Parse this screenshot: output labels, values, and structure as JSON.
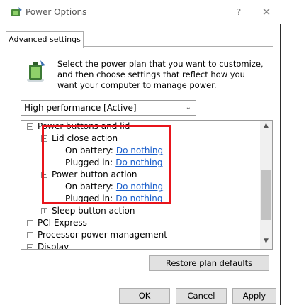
{
  "window": {
    "title": "Power Options",
    "help_glyph": "?",
    "close_glyph": "✕"
  },
  "tab": {
    "label": "Advanced settings"
  },
  "intro": {
    "text": "Select the power plan that you want to customize, and then choose settings that reflect how you want your computer to manage power."
  },
  "plan": {
    "selected": "High performance [Active]",
    "chevron": "⌄"
  },
  "tree": {
    "power_buttons": {
      "toggle": "−",
      "label": "Power buttons and lid"
    },
    "lid_close": {
      "toggle": "−",
      "label": "Lid close action",
      "on_battery_label": "On battery:",
      "on_battery_value": "Do nothing",
      "plugged_in_label": "Plugged in:",
      "plugged_in_value": "Do nothing"
    },
    "power_button": {
      "toggle": "−",
      "label": "Power button action",
      "on_battery_label": "On battery:",
      "on_battery_value": "Do nothing",
      "plugged_in_label": "Plugged in:",
      "plugged_in_value": "Do nothing"
    },
    "sleep_button": {
      "toggle": "+",
      "label": "Sleep button action"
    },
    "pci_express": {
      "toggle": "+",
      "label": "PCI Express"
    },
    "processor": {
      "toggle": "+",
      "label": "Processor power management"
    },
    "display": {
      "toggle": "+",
      "label": "Display"
    },
    "scroll_up": "▲",
    "scroll_down": "▼"
  },
  "buttons": {
    "restore": "Restore plan defaults",
    "ok": "OK",
    "cancel": "Cancel",
    "apply": "Apply"
  },
  "colors": {
    "link": "#1a5ecb",
    "highlight": "#e8141b",
    "button_face": "#e1e1e1"
  },
  "icons": {
    "app": "battery-power-icon",
    "intro": "battery-power-icon"
  }
}
